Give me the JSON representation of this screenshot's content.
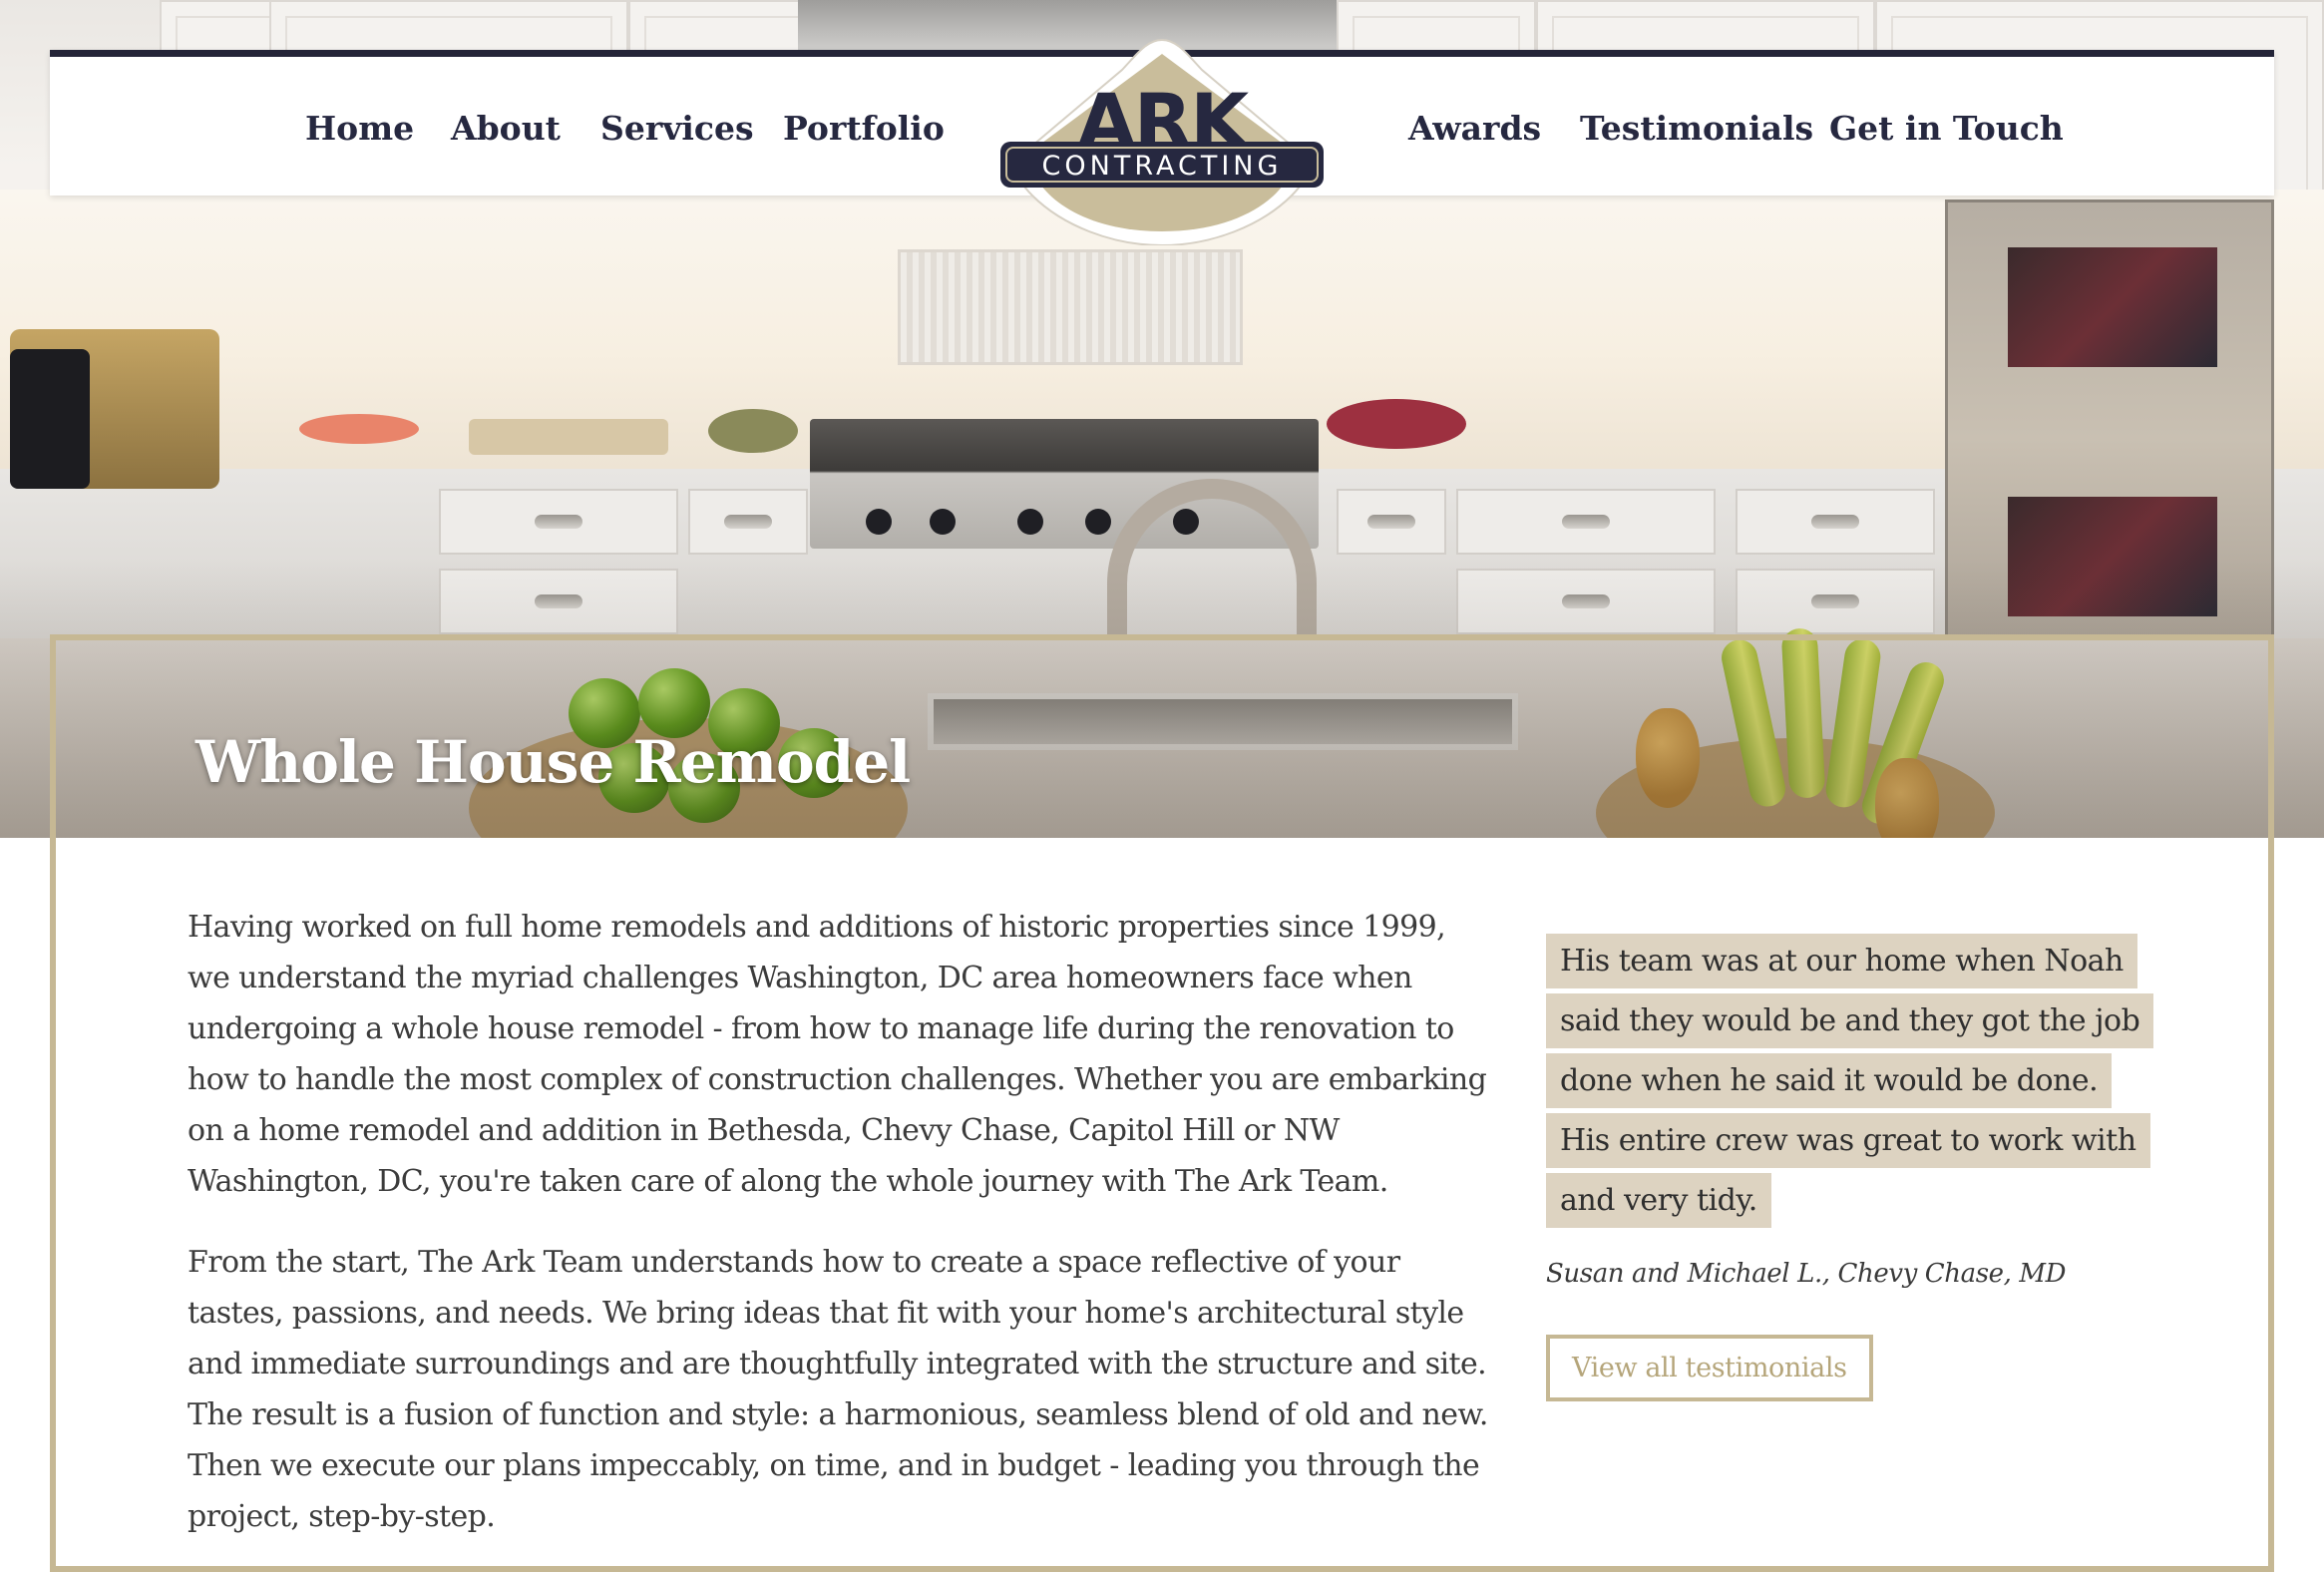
{
  "nav": {
    "home": "Home",
    "about": "About",
    "services": "Services",
    "portfolio": "Portfolio",
    "awards": "Awards",
    "testimonials": "Testimonials",
    "get_in_touch": "Get in Touch"
  },
  "logo": {
    "name": "ARK",
    "tagline": "CONTRACTING"
  },
  "hero": {
    "title": "Whole House Remodel"
  },
  "main": {
    "paragraphs": [
      "Having worked on full home remodels and additions of historic properties since 1999, we understand the myriad challenges Washington, DC area homeowners face when undergoing a whole house remodel - from how to manage life during the renovation to how to handle the most complex of construction challenges. Whether you are embarking on a home remodel and addition in Bethesda, Chevy Chase, Capitol Hill or NW Washington, DC, you're taken care of along the whole journey with The Ark Team.",
      "From the start, The Ark Team understands how to create a space reflective of your tastes, passions, and needs. We bring ideas that fit with your home's architectural style and immediate surroundings and are thoughtfully integrated with the structure and site. The result is a fusion of function and style: a harmonious, seamless blend of old and new. Then we execute our plans impeccably, on time, and in budget - leading you through the project, step-by-step."
    ]
  },
  "testimonial": {
    "quote": "His team was at our home when Noah said they would be and they got the job done when he said it would be done. His entire crew was great to work with and very tidy.",
    "author": "Susan and Michael L., Chevy Chase, MD",
    "button": "View all testimonials"
  },
  "colors": {
    "navy": "#242538",
    "gold": "#c6b894",
    "highlight": "#ddd3c1"
  }
}
